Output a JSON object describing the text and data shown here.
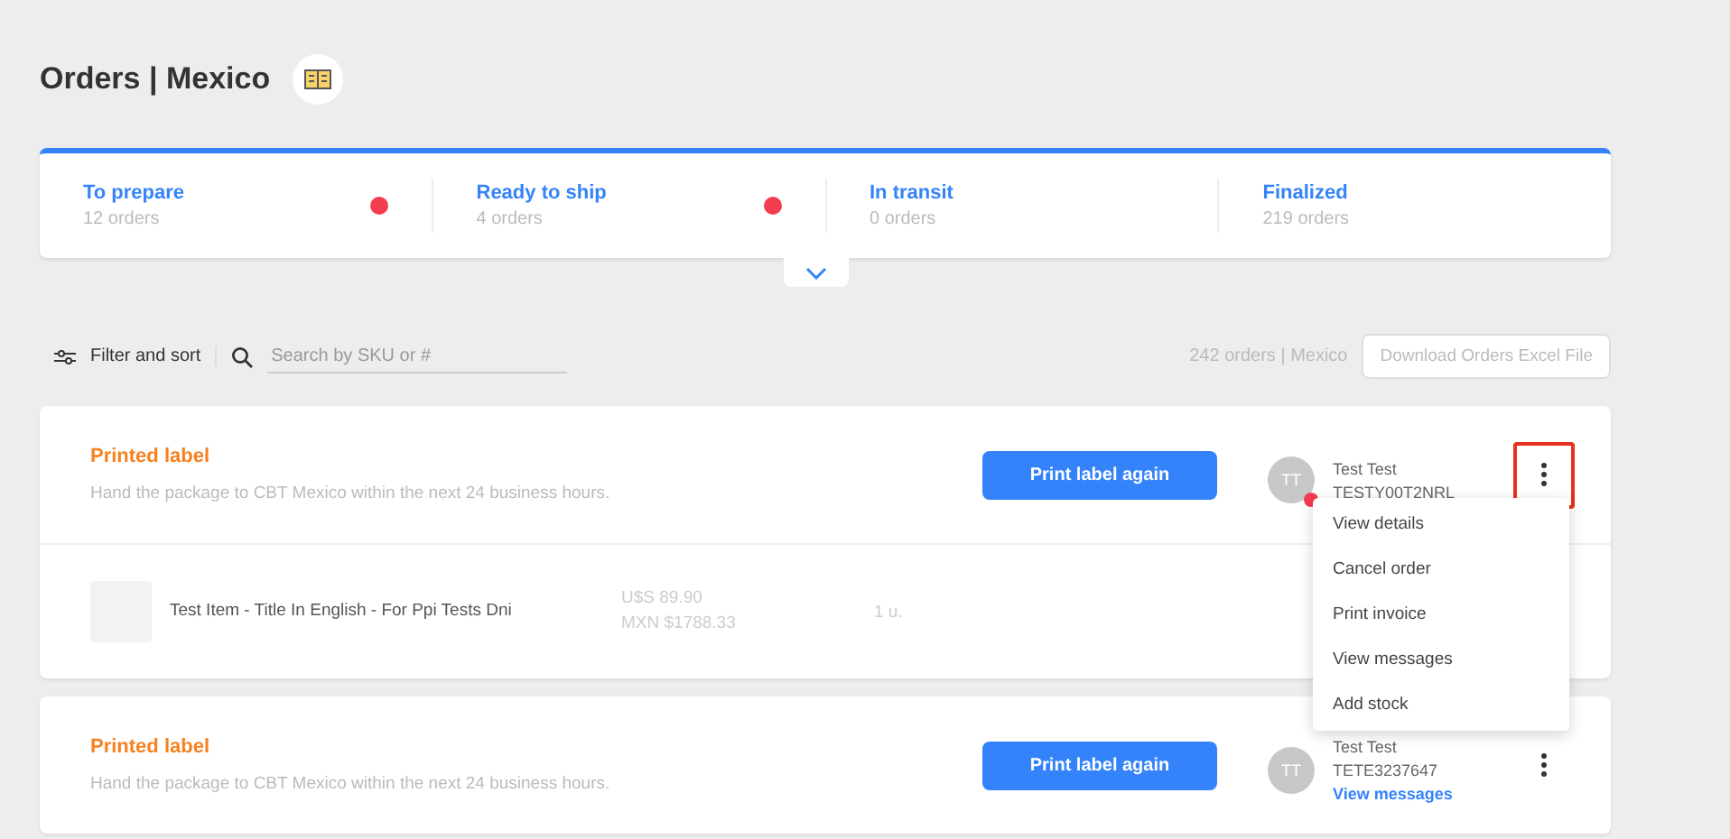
{
  "header": {
    "title": "Orders | Mexico"
  },
  "status_tabs": [
    {
      "label": "To prepare",
      "count": "12 orders",
      "alert": true
    },
    {
      "label": "Ready to ship",
      "count": "4 orders",
      "alert": true
    },
    {
      "label": "In transit",
      "count": "0 orders",
      "alert": false
    },
    {
      "label": "Finalized",
      "count": "219 orders",
      "alert": false
    }
  ],
  "toolbar": {
    "filter_label": "Filter and sort",
    "search": {
      "placeholder": "Search by SKU or #"
    },
    "summary": "242 orders | Mexico",
    "download_button": "Download Orders Excel File"
  },
  "orders": [
    {
      "status": "Printed label",
      "description": "Hand the package to CBT Mexico within the next 24 business hours.",
      "action": "Print label again",
      "buyer": {
        "name": "Test Test",
        "initials": "TT",
        "id": "TESTY00T2NRL",
        "unread": true
      },
      "menu_highlighted": true,
      "items": [
        {
          "title": "Test Item - Title In English - For Ppi Tests Dni",
          "price": "U$S 89.90",
          "local_price": "MXN $1788.33",
          "quantity": "1 u."
        }
      ]
    },
    {
      "status": "Printed label",
      "description": "Hand the package to CBT Mexico within the next 24 business hours.",
      "action": "Print label again",
      "buyer": {
        "name": "Test Test",
        "initials": "TT",
        "id": "TETE3237647",
        "unread": false,
        "link": "View messages"
      },
      "menu_highlighted": false
    }
  ],
  "context_menu": {
    "items": [
      "View details",
      "Cancel order",
      "Print invoice",
      "View messages",
      "Add stock"
    ]
  }
}
